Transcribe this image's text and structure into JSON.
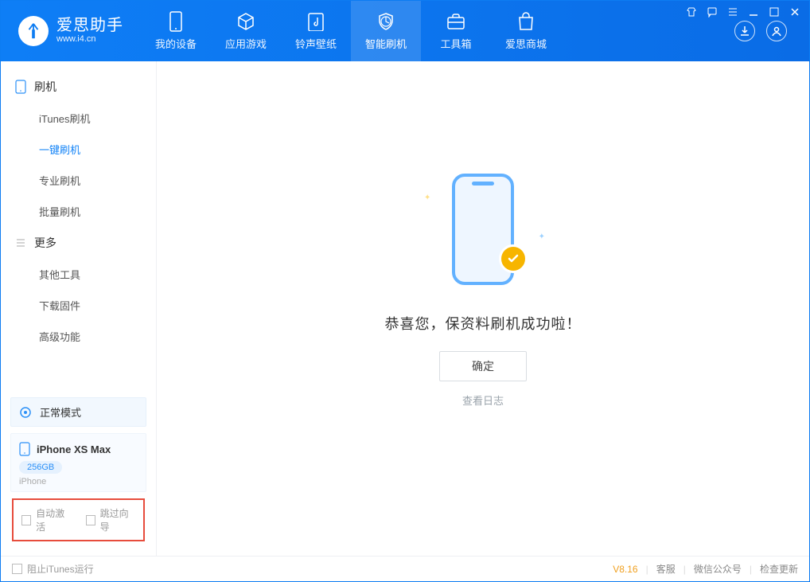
{
  "brand": {
    "name": "爱思助手",
    "url": "www.i4.cn"
  },
  "tabs": [
    {
      "label": "我的设备",
      "icon": "device"
    },
    {
      "label": "应用游戏",
      "icon": "cube"
    },
    {
      "label": "铃声壁纸",
      "icon": "music"
    },
    {
      "label": "智能刷机",
      "icon": "shield"
    },
    {
      "label": "工具箱",
      "icon": "toolbox"
    },
    {
      "label": "爱思商城",
      "icon": "bag"
    }
  ],
  "sidebar": {
    "group1": {
      "title": "刷机"
    },
    "items1": [
      {
        "label": "iTunes刷机"
      },
      {
        "label": "一键刷机"
      },
      {
        "label": "专业刷机"
      },
      {
        "label": "批量刷机"
      }
    ],
    "group2": {
      "title": "更多"
    },
    "items2": [
      {
        "label": "其他工具"
      },
      {
        "label": "下载固件"
      },
      {
        "label": "高级功能"
      }
    ]
  },
  "device": {
    "mode": "正常模式",
    "name": "iPhone XS Max",
    "capacity": "256GB",
    "subtype": "iPhone"
  },
  "options": {
    "auto_activate": "自动激活",
    "skip_guide": "跳过向导"
  },
  "main": {
    "success_msg": "恭喜您，保资料刷机成功啦！",
    "confirm_btn": "确定",
    "view_log": "查看日志"
  },
  "statusbar": {
    "block_itunes": "阻止iTunes运行",
    "version": "V8.16",
    "cs": "客服",
    "wechat": "微信公众号",
    "update": "检查更新"
  }
}
